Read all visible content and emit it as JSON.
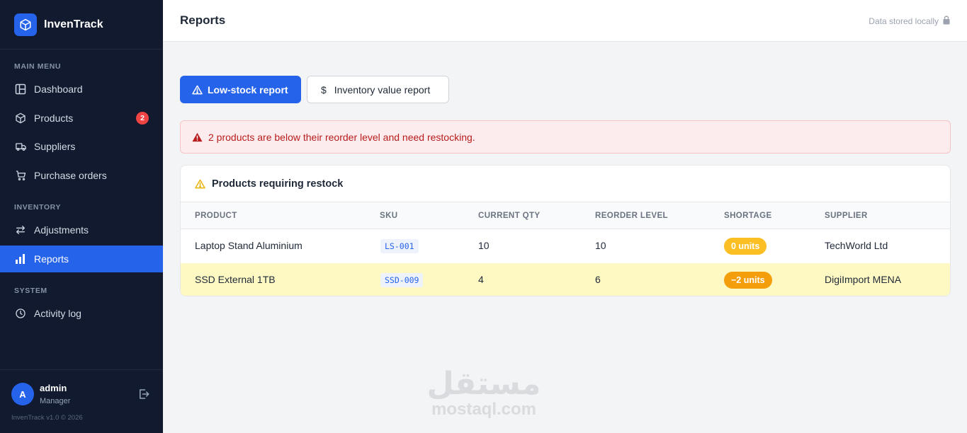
{
  "app": {
    "name": "InvenTrack",
    "version": "InvenTrack v1.0 © 2026"
  },
  "sidebar": {
    "sections": [
      {
        "label": "MAIN MENU"
      },
      {
        "label": "INVENTORY"
      },
      {
        "label": "SYSTEM"
      }
    ],
    "items": [
      {
        "label": "Dashboard",
        "icon": "dashboard-icon"
      },
      {
        "label": "Products",
        "icon": "box-icon",
        "badge": "2"
      },
      {
        "label": "Suppliers",
        "icon": "truck-icon"
      },
      {
        "label": "Purchase orders",
        "icon": "cart-icon"
      },
      {
        "label": "Adjustments",
        "icon": "arrows-icon"
      },
      {
        "label": "Reports",
        "icon": "bar-chart-icon",
        "active": true
      },
      {
        "label": "Activity log",
        "icon": "clock-icon"
      }
    ]
  },
  "user": {
    "initial": "A",
    "name": "admin",
    "role": "Manager"
  },
  "header": {
    "title": "Reports",
    "storage_status": "Data stored locally"
  },
  "tabs": {
    "low_stock": "Low-stock report",
    "inventory_value": "Inventory value report",
    "inventory_value_symbol": "$"
  },
  "alert": {
    "message": "2 products are below their reorder level and need restocking."
  },
  "restock": {
    "title": "Products requiring restock",
    "columns": [
      "PRODUCT",
      "SKU",
      "CURRENT QTY",
      "REORDER LEVEL",
      "SHORTAGE",
      "SUPPLIER"
    ],
    "rows": [
      {
        "product": "Laptop Stand Aluminium",
        "sku": "LS-001",
        "current_qty": "10",
        "reorder_level": "10",
        "shortage": "0 units",
        "supplier": "TechWorld Ltd"
      },
      {
        "product": "SSD External 1TB",
        "sku": "SSD-009",
        "current_qty": "4",
        "reorder_level": "6",
        "shortage": "−2 units",
        "supplier": "DigiImport MENA"
      }
    ]
  },
  "colors": {
    "accent": "#2563eb",
    "sidebar_bg": "#111a2e",
    "danger": "#ef4444",
    "warning_pill": "#fbbf24",
    "warning_pill_strong": "#f59e0b",
    "row_highlight": "#fef9c3"
  },
  "watermark": {
    "arabic": "مستقل",
    "latin": "mostaql.com"
  }
}
